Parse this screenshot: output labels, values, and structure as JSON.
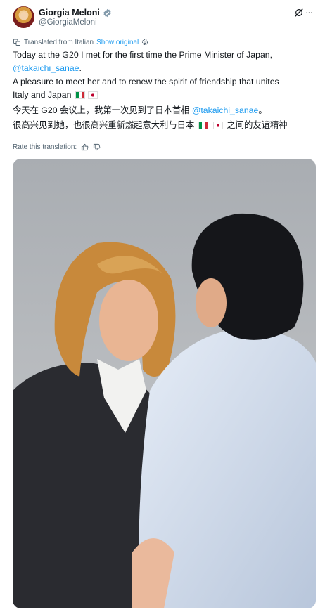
{
  "user": {
    "display_name": "Giorgia Meloni",
    "handle": "@GiorgiaMeloni"
  },
  "translation": {
    "label": "Translated from Italian",
    "show_original": "Show original"
  },
  "tweet": {
    "line1": "Today at the G20 I met for the first time the Prime Minister of Japan,",
    "mention": "@takaichi_sanae",
    "mention_suffix": ".",
    "line3": "A pleasure to meet her and to renew the spirit of friendship that unites",
    "line4": "Italy and Japan"
  },
  "tweet_zh": {
    "line1_prefix": "今天在 G20 会议上，我第一次见到了日本首相 ",
    "mention": "@takaichi_sanae",
    "line1_suffix": "。",
    "line2_prefix": "很高兴见到她，也很高兴重新燃起意大利与日本",
    "line2_suffix": " 之间的友谊精神"
  },
  "rate": {
    "label": "Rate this translation:"
  },
  "icons": {
    "verified": "verified-badge-icon",
    "grok": "grok-icon",
    "more": "more-icon",
    "translate": "translate-icon",
    "gear": "gear-icon",
    "thumbs_up": "thumbs-up-icon",
    "thumbs_down": "thumbs-down-icon"
  },
  "colors": {
    "accent": "#1d9bf0",
    "text": "#0f1419",
    "secondary": "#536471"
  }
}
